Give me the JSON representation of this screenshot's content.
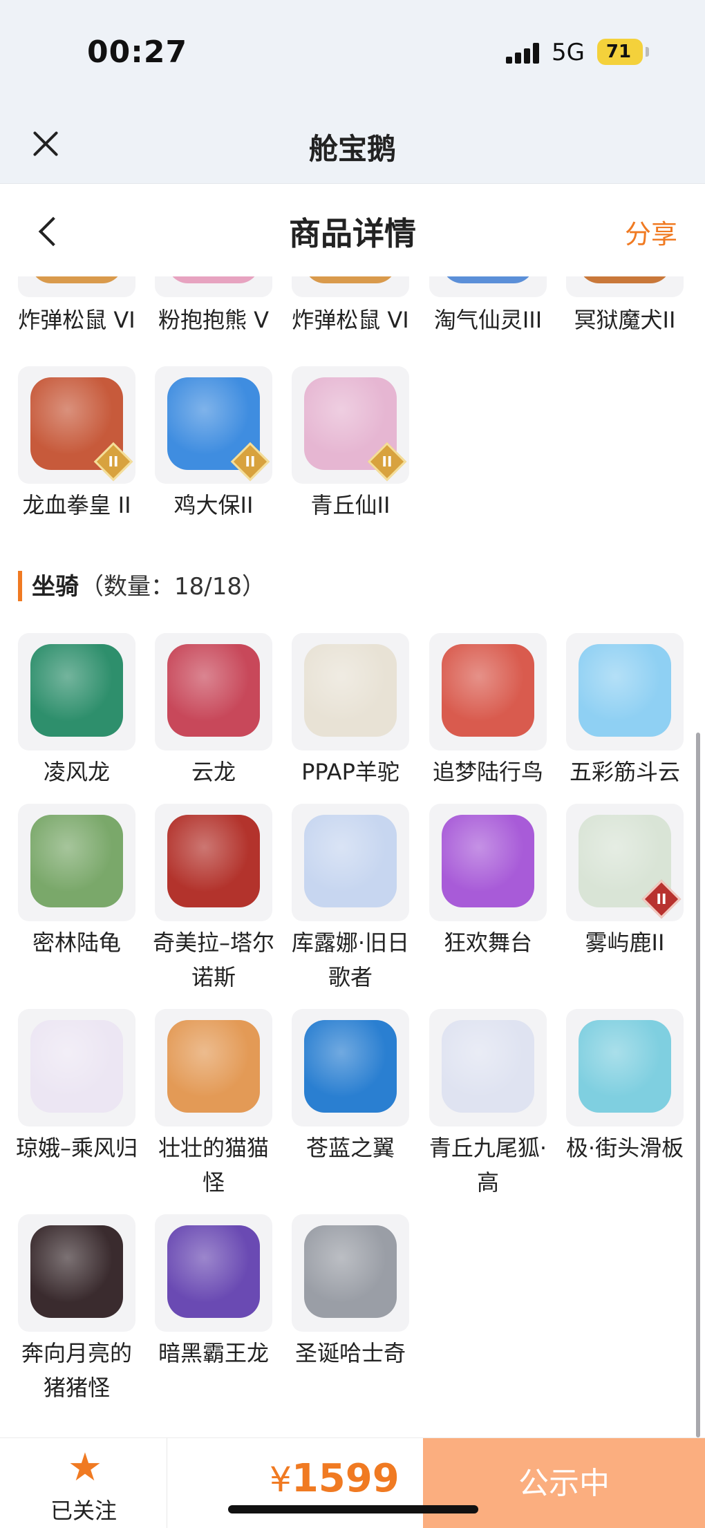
{
  "status": {
    "time": "00:27",
    "network": "5G",
    "battery": "71"
  },
  "app": {
    "title": "舱宝鹅"
  },
  "nav": {
    "title": "商品详情",
    "share": "分享"
  },
  "pets_partial_top": [
    {
      "name": "炸弹松鼠 VI",
      "color": "#d99a4c"
    },
    {
      "name": "粉抱抱熊 V",
      "color": "#e7a3c0"
    },
    {
      "name": "炸弹松鼠 VI",
      "color": "#d99a4c"
    },
    {
      "name": "淘气仙灵III",
      "color": "#5b8fd8"
    },
    {
      "name": "冥狱魔犬II",
      "color": "#c9783a"
    }
  ],
  "pets_row": [
    {
      "name": "龙血拳皇 II",
      "color": "#c75a3b",
      "badge": "II"
    },
    {
      "name": "鸡大保II",
      "color": "#3f8de0",
      "badge": "II"
    },
    {
      "name": "青丘仙II",
      "color": "#e6b6d2",
      "badge": "II"
    }
  ],
  "mounts": {
    "title": "坐骑",
    "count": "（数量：18/18）",
    "items": [
      {
        "name": "凌风龙",
        "color": "#2e8f6c"
      },
      {
        "name": "云龙",
        "color": "#c8485a"
      },
      {
        "name": "PPAP羊驼",
        "color": "#e8e2d5"
      },
      {
        "name": "追梦陆行鸟",
        "color": "#d95b4e"
      },
      {
        "name": "五彩筋斗云",
        "color": "#8fd0f3"
      },
      {
        "name": "密林陆龟",
        "color": "#7aa86a"
      },
      {
        "name": "奇美拉–塔尔诺斯",
        "color": "#b3332c"
      },
      {
        "name": "库露娜·旧日歌者",
        "color": "#c7d6f0"
      },
      {
        "name": "狂欢舞台",
        "color": "#a85bd8"
      },
      {
        "name": "雾屿鹿II",
        "color": "#d9e4d6",
        "badge": "II"
      },
      {
        "name": "琼娥–乘风归",
        "color": "#ece6f3"
      },
      {
        "name": "壮壮的猫猫怪",
        "color": "#e39a56"
      },
      {
        "name": "苍蓝之翼",
        "color": "#2a7fd1"
      },
      {
        "name": "青丘九尾狐·高",
        "color": "#dfe3f1"
      },
      {
        "name": "极·街头滑板",
        "color": "#7fcfe0"
      },
      {
        "name": "奔向月亮的猪猪怪",
        "color": "#3a2b2e"
      },
      {
        "name": "暗黑霸王龙",
        "color": "#6a4ab3"
      },
      {
        "name": "圣诞哈士奇",
        "color": "#9a9ea6"
      }
    ]
  },
  "footer": {
    "follow_label": "已关注",
    "currency": "¥",
    "price": "1599",
    "status_label": "公示中"
  },
  "colors": {
    "accent": "#f07a22",
    "status_button": "#fbae7f"
  }
}
